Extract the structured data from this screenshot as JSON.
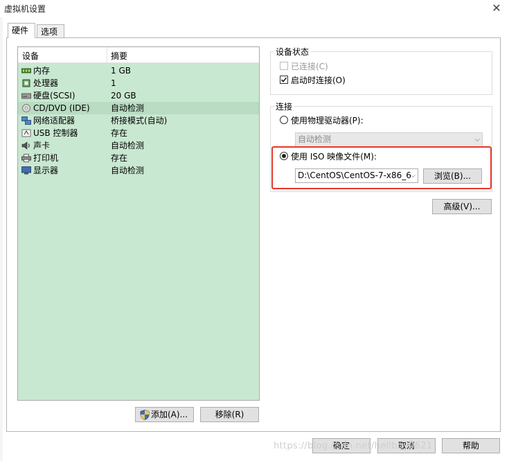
{
  "window": {
    "title": "虚拟机设置",
    "close_icon": "close-icon"
  },
  "tabs": [
    {
      "label": "硬件",
      "active": true
    },
    {
      "label": "选项",
      "active": false
    }
  ],
  "device_list": {
    "headers": {
      "device": "设备",
      "summary": "摘要"
    },
    "rows": [
      {
        "name": "内存",
        "summary": "1 GB",
        "icon": "memory-icon"
      },
      {
        "name": "处理器",
        "summary": "1",
        "icon": "processor-icon"
      },
      {
        "name": "硬盘(SCSI)",
        "summary": "20 GB",
        "icon": "harddisk-icon"
      },
      {
        "name": "CD/DVD (IDE)",
        "summary": "自动检测",
        "icon": "cd-dvd-icon",
        "selected": true
      },
      {
        "name": "网络适配器",
        "summary": "桥接模式(自动)",
        "icon": "network-adapter-icon"
      },
      {
        "name": "USB 控制器",
        "summary": "存在",
        "icon": "usb-icon"
      },
      {
        "name": "声卡",
        "summary": "自动检测",
        "icon": "sound-card-icon"
      },
      {
        "name": "打印机",
        "summary": "存在",
        "icon": "printer-icon"
      },
      {
        "name": "显示器",
        "summary": "自动检测",
        "icon": "display-icon"
      }
    ],
    "add_button": "添加(A)...",
    "remove_button": "移除(R)"
  },
  "device_status": {
    "title": "设备状态",
    "connected": {
      "label": "已连接(C)",
      "checked": false,
      "disabled": true
    },
    "connect_on_start": {
      "label": "启动时连接(O)",
      "checked": true
    }
  },
  "connection": {
    "title": "连接",
    "physical": {
      "label": "使用物理驱动器(P):",
      "selected": false,
      "value": "自动检测"
    },
    "iso": {
      "label": "使用 ISO 映像文件(M):",
      "selected": true,
      "value": "D:\\CentOS\\CentOS-7-x86_6",
      "browse_button": "浏览(B)..."
    }
  },
  "advanced_button": "高级(V)...",
  "footer": {
    "ok": "确定",
    "cancel": "取消",
    "help": "帮助"
  },
  "watermark": "https://blog.csdn.net/hellboy0621",
  "colors": {
    "accent_highlight": "#e8372c",
    "list_background": "#c9e8d1"
  }
}
